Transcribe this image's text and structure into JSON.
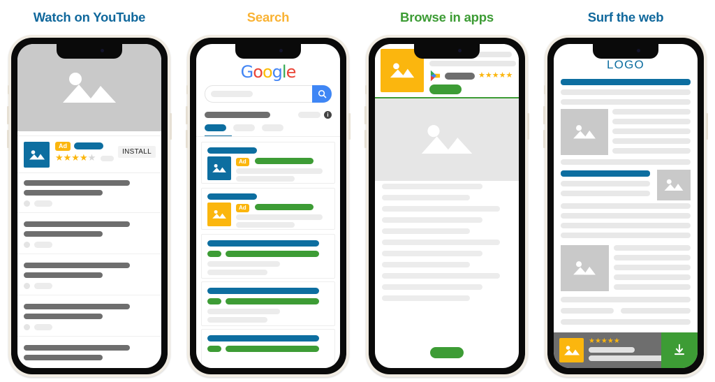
{
  "columns": [
    {
      "title": "Watch on YouTube",
      "title_color": "#10689c",
      "phone": {
        "ad": {
          "badge": "Ad",
          "install_label": "INSTALL",
          "rating_filled": 4,
          "rating_total": 5,
          "star_glyph": "★"
        },
        "list_items": 5
      }
    },
    {
      "title": "Search",
      "title_color": "#f9b233",
      "phone": {
        "logo": {
          "name": "google-logo",
          "letters": [
            {
              "char": "G",
              "color": "#4285F4"
            },
            {
              "char": "o",
              "color": "#EA4335"
            },
            {
              "char": "o",
              "color": "#FBBC05"
            },
            {
              "char": "g",
              "color": "#4285F4"
            },
            {
              "char": "l",
              "color": "#34A853"
            },
            {
              "char": "e",
              "color": "#EA4335"
            }
          ]
        },
        "search": {
          "placeholder": "",
          "value": "",
          "button_icon": "search-icon"
        },
        "info_icon": "i",
        "results": [
          {
            "type": "ad",
            "icon_color": "#0d6ea0",
            "badge": "Ad"
          },
          {
            "type": "ad",
            "icon_color": "#fbb60e",
            "badge": "Ad"
          },
          {
            "type": "organic"
          },
          {
            "type": "organic"
          },
          {
            "type": "organic"
          }
        ]
      }
    },
    {
      "title": "Browse in apps",
      "title_color": "#3d9c35",
      "phone": {
        "app_header": {
          "rating_stars": 5,
          "star_glyph": "★",
          "cta": ""
        },
        "body_lines": 11
      }
    },
    {
      "title": "Surf the web",
      "title_color": "#10689c",
      "phone": {
        "logo_text": "LOGO",
        "bottom_banner": {
          "rating_stars": 5,
          "star_glyph": "★",
          "download_icon": "download-icon"
        }
      }
    }
  ],
  "palette": {
    "blue": "#0d6ea0",
    "yellow": "#fbb60e",
    "green": "#3d9c35",
    "grey": "#6e6e6e",
    "light_grey": "#ececec",
    "hero_grey": "#c9c9c9",
    "frame_cream": "#f1ece3",
    "bezel_black": "#0a0a0a"
  }
}
